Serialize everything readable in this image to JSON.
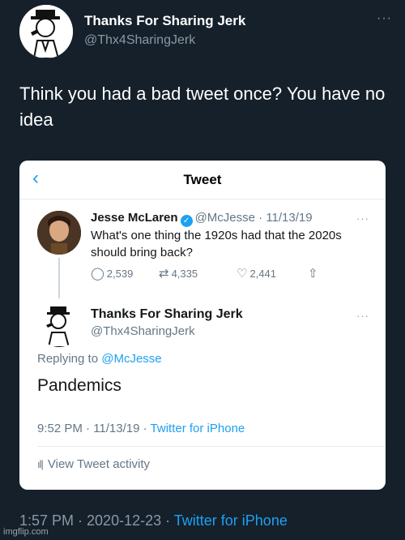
{
  "outer_tweet": {
    "name": "Thanks For Sharing Jerk",
    "handle": "@Thx4SharingJerk",
    "more": "···",
    "text": "Think you had a bad tweet once? You have no idea",
    "timestamp": "1:57 PM · 2020-12-23 · ",
    "source": "Twitter for iPhone"
  },
  "card": {
    "back": "‹",
    "title": "Tweet",
    "tweet1": {
      "name": "Jesse McLaren",
      "handle_date": "@McJesse · 11/13/19",
      "text": "What's one thing the 1920s had that the 2020s should bring back?",
      "more": "···",
      "replies": "2,539",
      "retweets": "4,335",
      "likes": "2,441"
    },
    "tweet2": {
      "name": "Thanks For Sharing Jerk",
      "handle": "@Thx4SharingJerk",
      "more": "···",
      "replying_prefix": "Replying to ",
      "replying_mention": "@McJesse",
      "text": "Pandemics",
      "meta": "9:52 PM · 11/13/19 · ",
      "source": "Twitter for iPhone",
      "activity": "View Tweet activity"
    }
  },
  "watermark": "imgflip.com",
  "colors": {
    "background": "#15202b",
    "accent": "#1da1f2",
    "muted": "#8899a6"
  },
  "icons": [
    "character-avatar",
    "person-avatar",
    "back-chevron-icon",
    "verified-icon",
    "reply-icon",
    "retweet-icon",
    "like-icon",
    "share-icon",
    "activity-icon"
  ]
}
